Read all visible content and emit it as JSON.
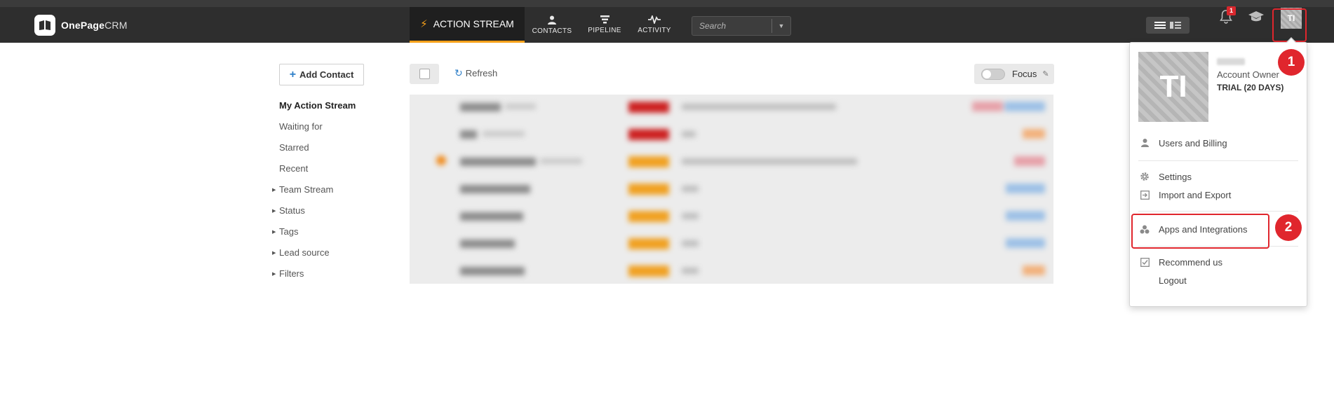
{
  "app": {
    "logo_name": "OnePage",
    "logo_suffix": "CRM"
  },
  "nav": {
    "active": "ACTION STREAM",
    "contacts": "CONTACTS",
    "pipeline": "PIPELINE",
    "activity": "ACTIVITY"
  },
  "search": {
    "placeholder": "Search"
  },
  "notifications": {
    "count": "1"
  },
  "user": {
    "initials": "TI",
    "role": "Account Owner",
    "plan": "TRIAL (20 DAYS)"
  },
  "sidebar": {
    "add_contact": "Add Contact",
    "links": [
      "My Action Stream",
      "Waiting for",
      "Starred",
      "Recent"
    ],
    "groups": [
      "Team Stream",
      "Status",
      "Tags",
      "Lead source",
      "Filters"
    ]
  },
  "toolbar": {
    "refresh": "Refresh",
    "focus": "Focus"
  },
  "menu": {
    "items": [
      "Users and Billing",
      "Settings",
      "Import and Export",
      "Apps and Integrations",
      "Recommend us",
      "Logout"
    ]
  },
  "callouts": [
    "1",
    "2"
  ],
  "colors": {
    "accent": "#f7a11a",
    "callout": "#e0262d",
    "link_blue": "#2e7fc8",
    "header": "#2e2e2e"
  }
}
